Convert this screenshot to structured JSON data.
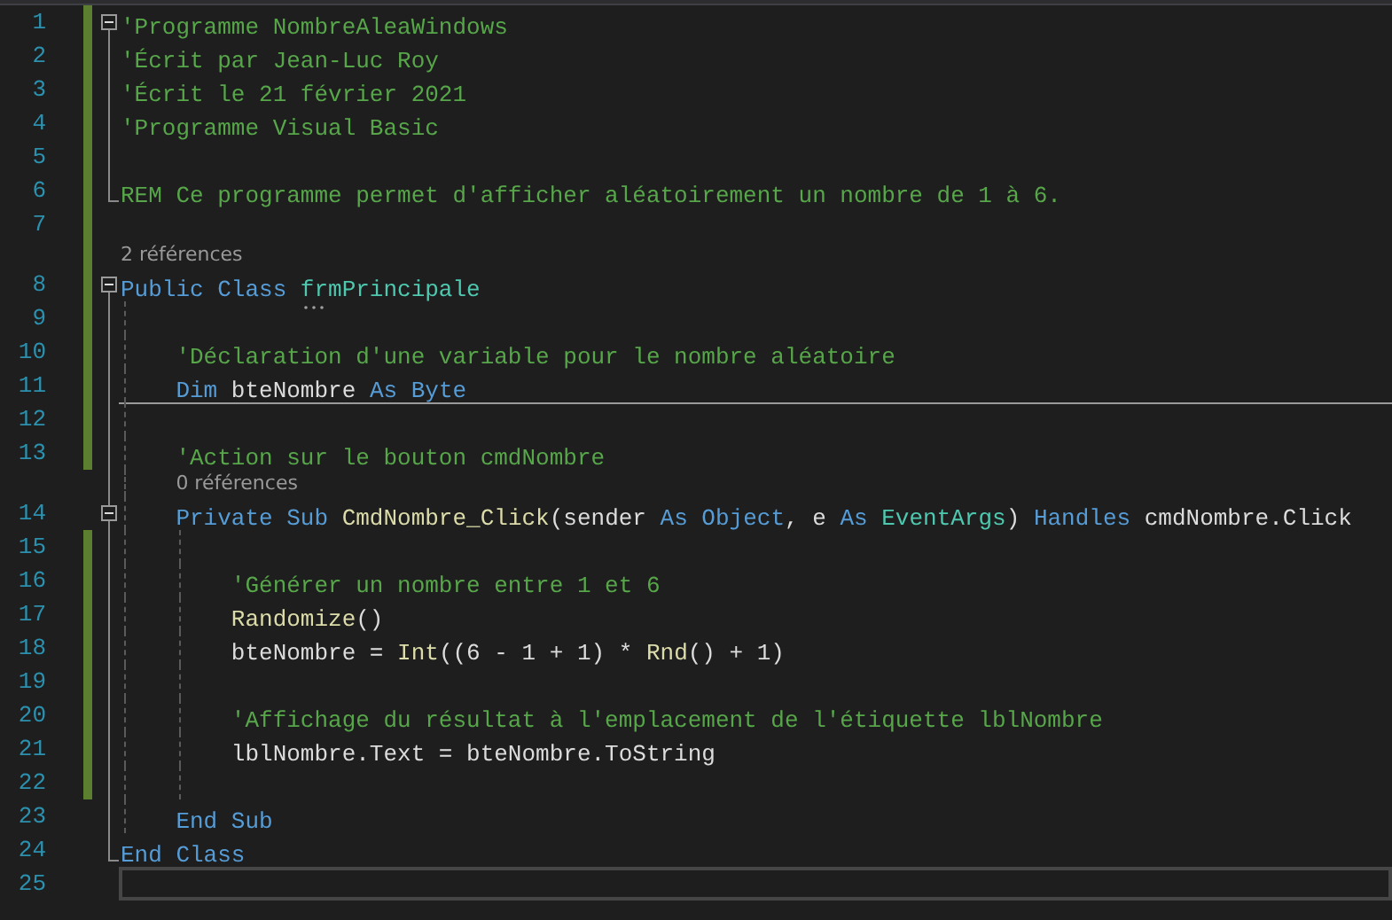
{
  "editor": {
    "lines": [
      {
        "number": "1",
        "modified": true,
        "kind": "start",
        "tokens": [
          {
            "kind": "comment",
            "text": "'Programme NombreAleaWindows"
          }
        ]
      },
      {
        "number": "2",
        "modified": true,
        "kind": "inside",
        "tokens": [
          {
            "kind": "comment",
            "text": "'Écrit par Jean-Luc Roy"
          }
        ]
      },
      {
        "number": "3",
        "modified": true,
        "kind": "inside",
        "tokens": [
          {
            "kind": "comment",
            "text": "'Écrit le 21 février 2021"
          }
        ]
      },
      {
        "number": "4",
        "modified": true,
        "kind": "inside",
        "tokens": [
          {
            "kind": "comment",
            "text": "'Programme Visual Basic"
          }
        ]
      },
      {
        "number": "5",
        "modified": true,
        "kind": "inside"
      },
      {
        "number": "6",
        "modified": true,
        "kind": "end",
        "tokens": [
          {
            "kind": "comment",
            "text": "REM Ce programme permet d'afficher aléatoirement un nombre de 1 à 6."
          }
        ]
      },
      {
        "number": "7",
        "modified": true,
        "kind": "none"
      },
      {
        "number": "8",
        "modified": true,
        "kind": "start",
        "codelens": "2 références",
        "tokens": [
          {
            "kind": "keyword",
            "text": "Public Class "
          },
          {
            "kind": "type",
            "text": "frmPrincipale",
            "hint": true
          }
        ]
      },
      {
        "number": "9",
        "modified": true,
        "kind": "inside"
      },
      {
        "number": "10",
        "modified": true,
        "kind": "inside",
        "tokens": [
          {
            "kind": "comment",
            "text": "    'Déclaration d'une variable pour le nombre aléatoire"
          }
        ]
      },
      {
        "number": "11",
        "modified": true,
        "kind": "inside",
        "tokens": [
          {
            "kind": "keyword",
            "text": "    Dim "
          },
          {
            "kind": "plain",
            "text": "bteNombre "
          },
          {
            "kind": "keyword",
            "text": "As Byte"
          }
        ]
      },
      {
        "number": "12",
        "modified": true,
        "kind": "inside",
        "separator": true
      },
      {
        "number": "13",
        "modified": true,
        "kind": "inside",
        "tokens": [
          {
            "kind": "comment",
            "text": "    'Action sur le bouton cmdNombre"
          }
        ]
      },
      {
        "number": "14",
        "modified": false,
        "kind": "start",
        "codelens": "0 références",
        "tokens": [
          {
            "kind": "keyword",
            "text": "    Private Sub "
          },
          {
            "kind": "method",
            "text": "CmdNombre_Click"
          },
          {
            "kind": "plain",
            "text": "("
          },
          {
            "kind": "plain",
            "text": "sender "
          },
          {
            "kind": "keyword",
            "text": "As Object"
          },
          {
            "kind": "plain",
            "text": ", e "
          },
          {
            "kind": "keyword",
            "text": "As "
          },
          {
            "kind": "type",
            "text": "EventArgs"
          },
          {
            "kind": "plain",
            "text": ") "
          },
          {
            "kind": "keyword",
            "text": "Handles "
          },
          {
            "kind": "plain",
            "text": "cmdNombre.Click"
          }
        ]
      },
      {
        "number": "15",
        "modified": true,
        "kind": "inside"
      },
      {
        "number": "16",
        "modified": true,
        "kind": "inside",
        "tokens": [
          {
            "kind": "comment",
            "text": "        'Générer un nombre entre 1 et 6"
          }
        ]
      },
      {
        "number": "17",
        "modified": true,
        "kind": "inside",
        "tokens": [
          {
            "kind": "method",
            "text": "        Randomize"
          },
          {
            "kind": "plain",
            "text": "()"
          }
        ]
      },
      {
        "number": "18",
        "modified": true,
        "kind": "inside",
        "tokens": [
          {
            "kind": "plain",
            "text": "        bteNombre = "
          },
          {
            "kind": "method",
            "text": "Int"
          },
          {
            "kind": "plain",
            "text": "((6 - 1 + 1) * "
          },
          {
            "kind": "method",
            "text": "Rnd"
          },
          {
            "kind": "plain",
            "text": "() + 1)"
          }
        ]
      },
      {
        "number": "19",
        "modified": true,
        "kind": "inside"
      },
      {
        "number": "20",
        "modified": true,
        "kind": "inside",
        "tokens": [
          {
            "kind": "comment",
            "text": "        'Affichage du résultat à l'emplacement de l'étiquette lblNombre"
          }
        ]
      },
      {
        "number": "21",
        "modified": true,
        "kind": "inside",
        "tokens": [
          {
            "kind": "plain",
            "text": "        lblNombre.Text = bteNombre.ToString"
          }
        ]
      },
      {
        "number": "22",
        "modified": true,
        "kind": "inside"
      },
      {
        "number": "23",
        "modified": false,
        "kind": "end",
        "tokens": [
          {
            "kind": "keyword",
            "text": "    End Sub"
          }
        ]
      },
      {
        "number": "24",
        "modified": false,
        "kind": "end",
        "tokens": [
          {
            "kind": "keyword",
            "text": "End Class"
          }
        ]
      },
      {
        "number": "25",
        "modified": false,
        "kind": "none",
        "current": true
      }
    ]
  }
}
